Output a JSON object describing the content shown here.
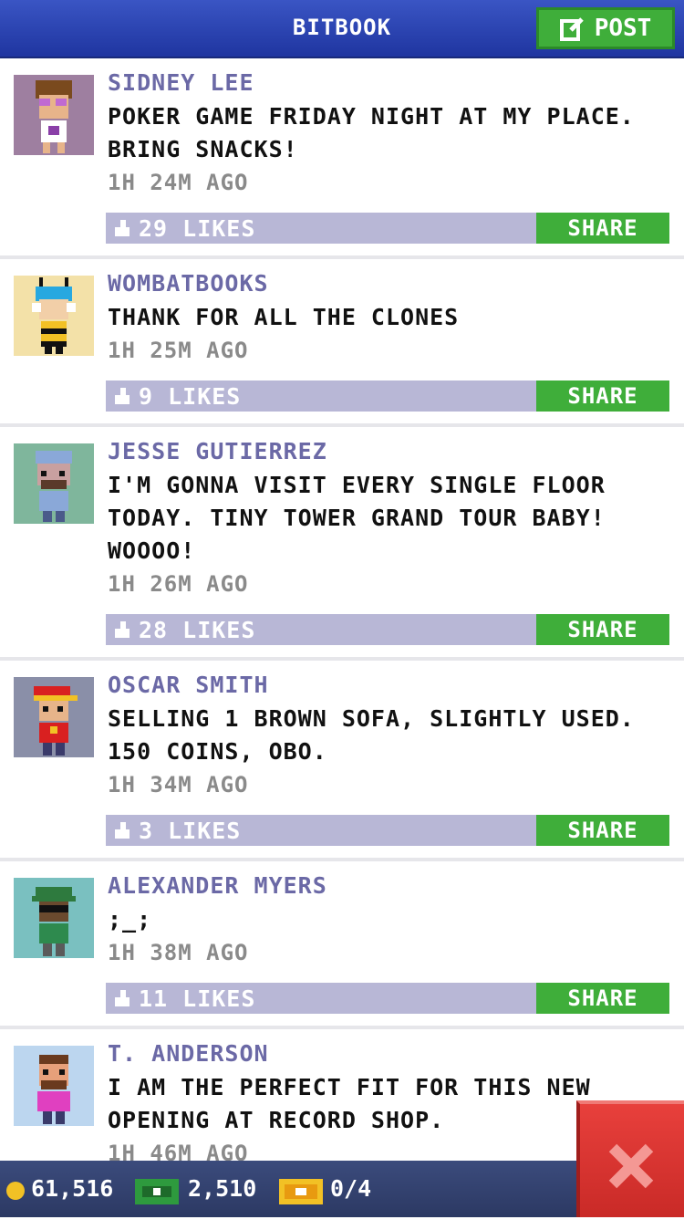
{
  "header": {
    "title": "BITBOOK",
    "post_label": "POST"
  },
  "posts": [
    {
      "name": "SIDNEY LEE",
      "message": "POKER GAME FRIDAY NIGHT AT MY PLACE. BRING SNACKS!",
      "time": "1H 24M AGO",
      "likes": "29 LIKES",
      "share": "SHARE",
      "avatar_bg": "#9e7fa0"
    },
    {
      "name": "WOMBATBOOKS",
      "message": "THANK FOR ALL THE CLONES",
      "time": "1H 25M AGO",
      "likes": "9 LIKES",
      "share": "SHARE",
      "avatar_bg": "#f3e1a8"
    },
    {
      "name": "JESSE GUTIERREZ",
      "message": "I'M GONNA VISIT EVERY SINGLE FLOOR TODAY. TINY TOWER GRAND TOUR BABY! WOOOO!",
      "time": "1H 26M AGO",
      "likes": "28 LIKES",
      "share": "SHARE",
      "avatar_bg": "#7fb69c"
    },
    {
      "name": "OSCAR SMITH",
      "message": "SELLING 1 BROWN SOFA, SLIGHTLY USED. 150 COINS, OBO.",
      "time": "1H 34M AGO",
      "likes": "3 LIKES",
      "share": "SHARE",
      "avatar_bg": "#8a8fa8"
    },
    {
      "name": "ALEXANDER MYERS",
      "message": ";_;",
      "time": "1H 38M AGO",
      "likes": "11 LIKES",
      "share": "SHARE",
      "avatar_bg": "#7ac0c0"
    },
    {
      "name": "T. ANDERSON",
      "message": "I AM THE PERFECT FIT FOR THIS NEW OPENING AT RECORD SHOP.",
      "time": "1H 46M AGO",
      "likes": "",
      "share": "",
      "avatar_bg": "#bcd6ef"
    }
  ],
  "status": {
    "coins": "61,516",
    "bux": "2,510",
    "tickets": "0/4"
  },
  "colors": {
    "header": "#2a44b8",
    "accent_green": "#3fae3a",
    "like_bar": "#b8b7d6",
    "name": "#6b69a6",
    "close_red": "#d93330"
  },
  "icons": [
    "post-edit-icon",
    "thumbs-up-icon",
    "coin-icon",
    "bux-icon",
    "ticket-icon",
    "close-x-icon"
  ]
}
